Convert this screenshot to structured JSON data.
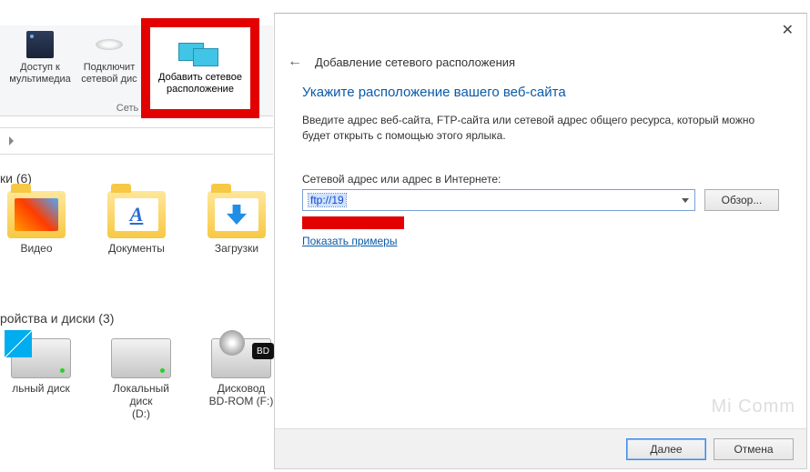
{
  "ribbon": {
    "items": [
      {
        "label": "Доступ к\nмультимедиа"
      },
      {
        "label": "Подключит\nсетевой дис"
      },
      {
        "label": "Добавить сетевое\nрасположение"
      }
    ],
    "section": "Сеть"
  },
  "explorer": {
    "folders_header": "ки (6)",
    "folders": [
      "Видео",
      "Документы",
      "Загрузки"
    ],
    "drives_header": "ройства и диски (3)",
    "drives": [
      {
        "label": "льный диск"
      },
      {
        "label": "Локальный диск\n(D:)"
      },
      {
        "label": "Дисковод\nBD-ROM (F:)",
        "badge": "BD"
      }
    ]
  },
  "wizard": {
    "title": "Добавление сетевого расположения",
    "heading": "Укажите расположение вашего веб-сайта",
    "desc": "Введите адрес веб-сайта, FTP-сайта или сетевой адрес общего ресурса, который можно будет открыть с помощью этого ярлыка.",
    "field_label": "Сетевой адрес или адрес в Интернете:",
    "input_value": "ftp://19",
    "browse": "Обзор...",
    "examples": "Показать примеры",
    "next": "Далее",
    "cancel": "Отмена"
  },
  "watermark": "Mi Comm"
}
